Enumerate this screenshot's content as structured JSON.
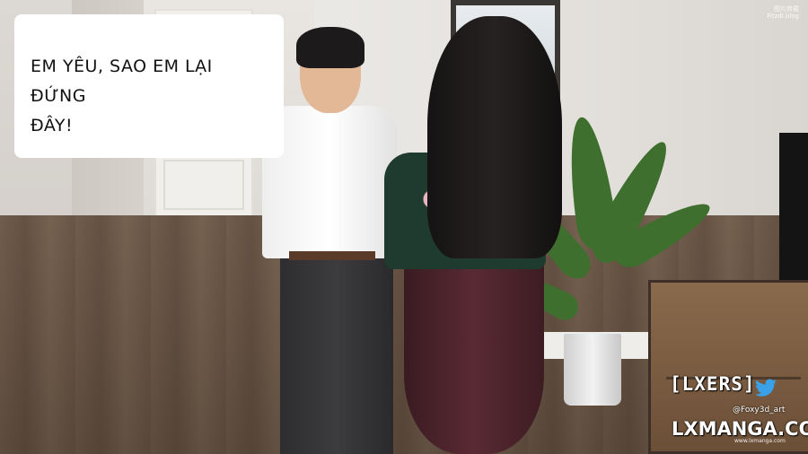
{
  "speech_bubble": {
    "line1": "EM YÊU, SAO EM LẠI ĐỨNG",
    "line2": "ĐÂY!"
  },
  "watermarks": {
    "top_right_line1": "图片转载",
    "top_right_line2": "Fitzdl.blog",
    "group_tag": "[LXERS]",
    "artist_handle": "@Foxy3d_art",
    "site": "LXMANGA.COM",
    "bottom_small": "www.lxmanga.com"
  },
  "icons": {
    "bird": "twitter-bird-icon"
  }
}
